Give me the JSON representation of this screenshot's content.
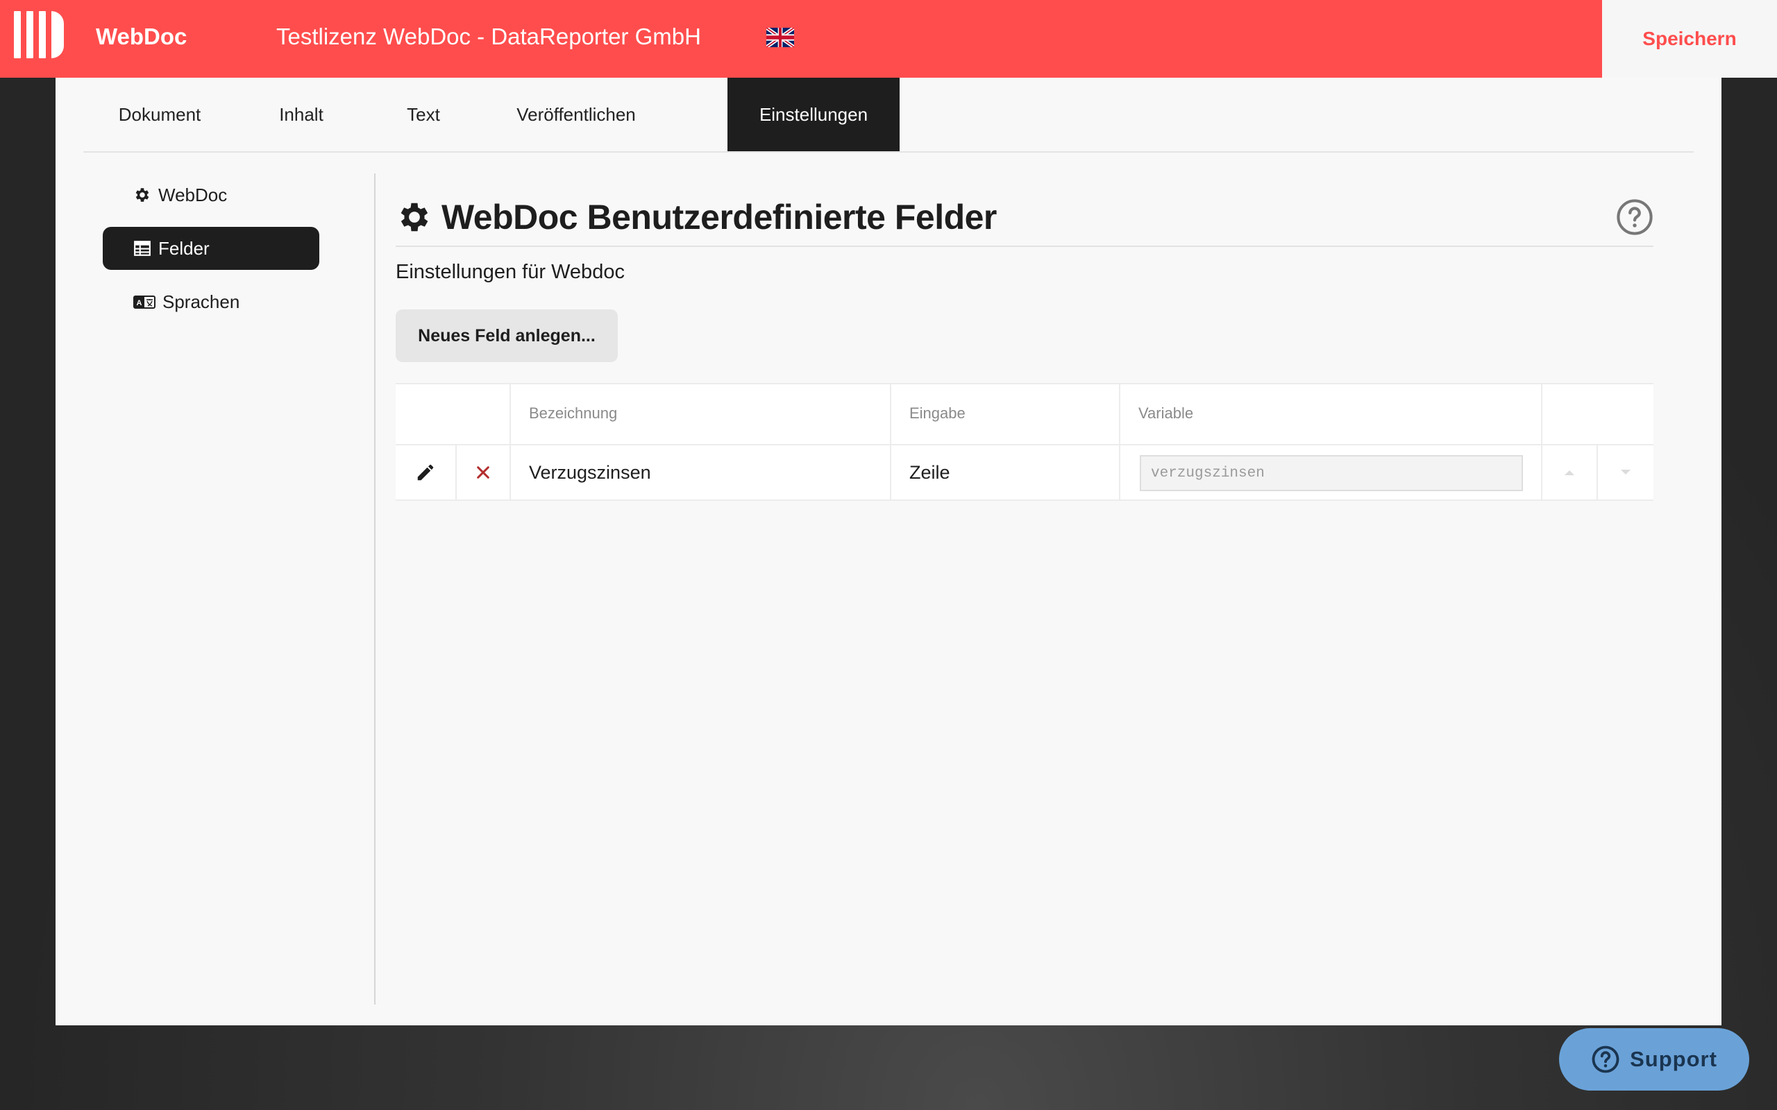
{
  "header": {
    "app_name": "WebDoc",
    "license": "Testlizenz WebDoc - DataReporter GmbH",
    "save_label": "Speichern",
    "language_flag": "uk-flag-icon",
    "accent_color": "#ff4d4d"
  },
  "tabs": [
    {
      "label": "Dokument"
    },
    {
      "label": "Inhalt"
    },
    {
      "label": "Text"
    },
    {
      "label": "Veröffentlichen"
    },
    {
      "label": "Einstellungen",
      "active": true
    }
  ],
  "sidebar": {
    "items": [
      {
        "label": "WebDoc",
        "icon": "gear-icon"
      },
      {
        "label": "Felder",
        "icon": "table-icon",
        "active": true
      },
      {
        "label": "Sprachen",
        "icon": "language-icon"
      }
    ]
  },
  "main": {
    "title": "WebDoc Benutzerdefinierte Felder",
    "subtitle": "Einstellungen für Webdoc",
    "new_field_label": "Neues Feld anlegen...",
    "table": {
      "headers": [
        "Bezeichnung",
        "Eingabe",
        "Variable"
      ],
      "rows": [
        {
          "bezeichnung": "Verzugszinsen",
          "eingabe": "Zeile",
          "variable": "verzugszinsen"
        }
      ]
    }
  },
  "support": {
    "label": "Support"
  }
}
